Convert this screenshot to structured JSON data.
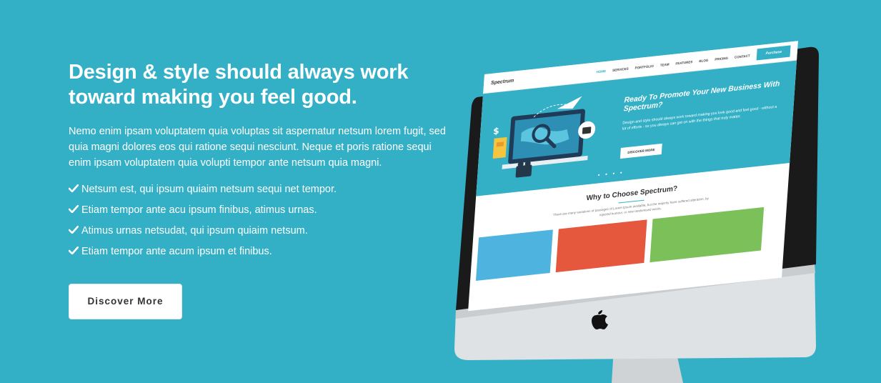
{
  "hero": {
    "headline_line1": "Design & style should always work",
    "headline_line2": "toward making you feel good.",
    "intro": "Nemo enim ipsam voluptatem quia voluptas sit aspernatur netsum lorem fugit, sed quia magni dolores eos qui ratione sequi nesciunt. Neque et poris ratione sequi enim ipsam voluptatem quia volupti tempor ante netsum quia magni.",
    "features": [
      "Netsum est, qui ipsum quiaim netsum sequi net tempor.",
      "Etiam tempor ante acu ipsum finibus, atimus urnas.",
      "Atimus urnas netsudat, qui ipsum quiaim netsum.",
      "Etiam tempor ante acum ipsum et finibus."
    ],
    "feature_icon": "check-icon",
    "cta_label": "Discover More"
  },
  "mockup": {
    "brand": "Spectrum",
    "nav": [
      "HOME",
      "SERVICES",
      "PORTFOLIO",
      "TEAM",
      "FEATURES",
      "BLOG",
      "PRICING",
      "CONTACT"
    ],
    "purchase_label": "Purchase",
    "hero_title": "Ready To Promote Your New Business With Spectrum?",
    "hero_text": "Design and style should always work toward making you look good and feel good - without a lot of efforts - so you always can get on with the things that truly matter.",
    "hero_button": "DISCOVER MORE",
    "why_title": "Why to Choose Spectrum?",
    "why_text": "There are many variations of passages of Lorem Ipsum available, but the majority have suffered alteration, by injected humour, or new randomised words.",
    "logo_icon": "apple-logo-icon"
  },
  "colors": {
    "background": "#33b0c6",
    "accent": "#33b0c6",
    "card_blue": "#4fb3e0",
    "card_red": "#e5583e",
    "card_green": "#7cc05a"
  }
}
